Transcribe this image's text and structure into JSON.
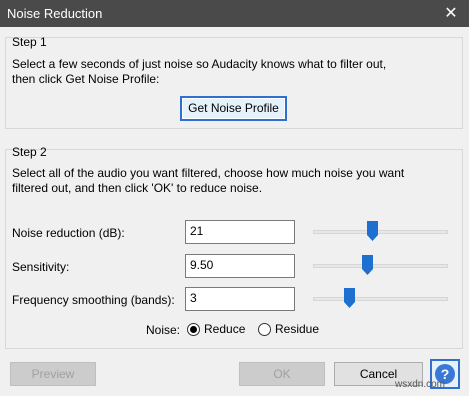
{
  "window": {
    "title": "Noise Reduction",
    "close_glyph": "✕"
  },
  "step1": {
    "title": "Step 1",
    "line1": "Select a few seconds of just noise so Audacity knows what to filter out,",
    "line2": "then click Get Noise Profile:",
    "button_label": "Get Noise Profile"
  },
  "step2": {
    "title": "Step 2",
    "line1": "Select all of the audio you want filtered, choose how much noise you want",
    "line2": "filtered out, and then click 'OK' to reduce noise.",
    "noise_reduction": {
      "label": "Noise reduction (dB):",
      "value": "21",
      "slider_fraction": 0.44
    },
    "sensitivity": {
      "label": "Sensitivity:",
      "value": "9.50",
      "slider_fraction": 0.4
    },
    "frequency_smoothing": {
      "label": "Frequency smoothing (bands):",
      "value": "3",
      "slider_fraction": 0.27
    },
    "noise_mode": {
      "label": "Noise:",
      "options": [
        "Reduce",
        "Residue"
      ],
      "selected": "Reduce"
    }
  },
  "buttons": {
    "preview": "Preview",
    "ok": "OK",
    "cancel": "Cancel",
    "help": "?"
  },
  "watermark": "wsxdn.com",
  "colors": {
    "titlebar": "#4a4a4a",
    "focus": "#2f6fd0",
    "slider_thumb": "#1f6fd0"
  }
}
